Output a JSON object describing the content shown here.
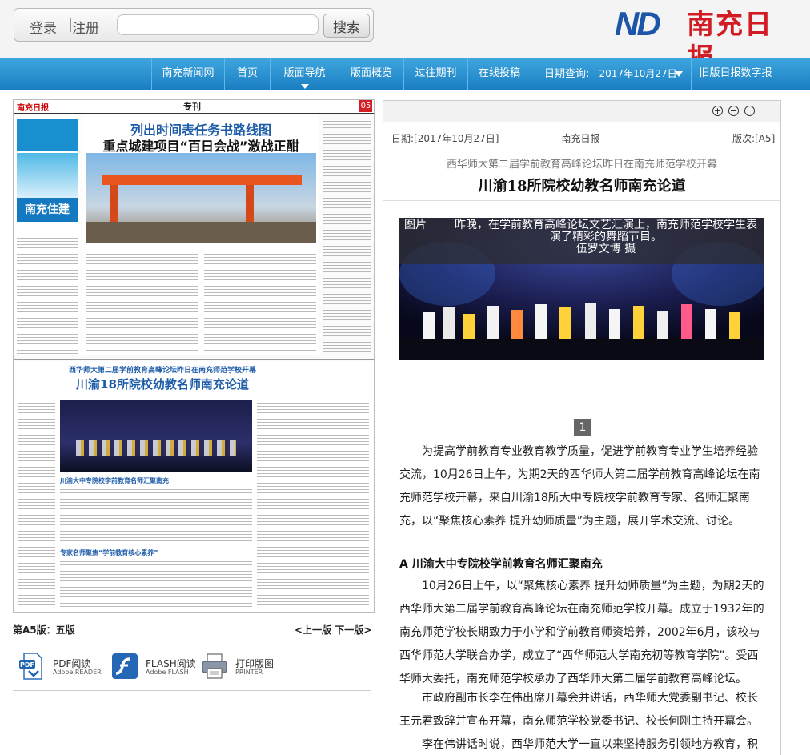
{
  "header": {
    "login": "登录",
    "sep": "|",
    "register": "注册",
    "search_placeholder": "",
    "search_button": "搜索",
    "logo_text": "ND",
    "logo_name": "南充日报"
  },
  "nav": {
    "items": [
      "南充新闻网",
      "首页",
      "版面导航",
      "版面概览",
      "过往期刊",
      "在线投稿",
      "日期查询:",
      "旧版日报数字报"
    ],
    "date_value": "2017年10月27日"
  },
  "page": {
    "masthead_tag": "专刊",
    "page_no": "05",
    "left_banner": "南充住建",
    "top_headline": "列出时间表任务书路线图",
    "top_headline2": "重点城建项目“百日会战”激战正酣",
    "bottom_kicker": "西华师大第二届学前教育高峰论坛昨日在南充师范学校开幕",
    "bottom_headline": "川渝18所院校幼教名师南充论道",
    "sec_a": "川渝大中专院校学前教育名师汇聚南充",
    "sec_b": "专家名师聚焦“学前教育核心素养”"
  },
  "edition": {
    "label": "第A5版：",
    "value": "五版",
    "prev": "<上一版",
    "next": "下一版>"
  },
  "downloads": [
    {
      "title": "PDF阅读",
      "sub": "Adobe READER",
      "icon": "pdf-icon"
    },
    {
      "title": "FLASH阅读",
      "sub": "Adobe FLASH",
      "icon": "flash-icon"
    },
    {
      "title": "打印版图",
      "sub": "PRINTER",
      "icon": "printer-icon"
    }
  ],
  "article": {
    "date": "日期:[2017年10月27日]",
    "source": "-- 南充日报 --",
    "edition": "版次:[A5]",
    "subtitle": "西华师大第二届学前教育高峰论坛昨日在南充师范学校开幕",
    "title": "川渝18所院校幼教名师南充论道",
    "photo_label": "图片",
    "photo_caption": "昨晚，在学前教育高峰论坛文艺汇演上，南充师范学校学生表演了精彩的舞蹈节目。",
    "photo_credit": "伍罗文博 摄",
    "photo_index": "1",
    "para1": "为提高学前教育专业教育教学质量，促进学前教育专业学生培养经验交流，10月26日上午，为期2天的西华师大第二届学前教育高峰论坛在南充师范学校开幕，来自川渝18所大中专院校学前教育专家、名师汇聚南充，以“聚焦核心素养 提升幼师质量”为主题，展开学术交流、讨论。",
    "section_a": "A  川渝大中专院校学前教育名师汇聚南充",
    "para2": "10月26日上午，以“聚焦核心素养 提升幼师质量”为主题，为期2天的西华师大第二届学前教育高峰论坛在南充师范学校开幕。成立于1932年的南充师范学校长期致力于小学和学前教育师资培养，2002年6月，该校与西华师范大学联合办学，成立了“西华师范大学南充初等教育学院”。受西华师大委托，南充师范学校承办了西华师大第二届学前教育高峰论坛。",
    "para3": "市政府副市长李在伟出席开幕会并讲话，西华师大党委副书记、校长王元君致辞并宣布开幕，南充师范学校党委书记、校长何刚主持开幕会。",
    "para4": "李在伟讲话时说，西华师范大学一直以来坚持服务引领地方教育，积"
  }
}
